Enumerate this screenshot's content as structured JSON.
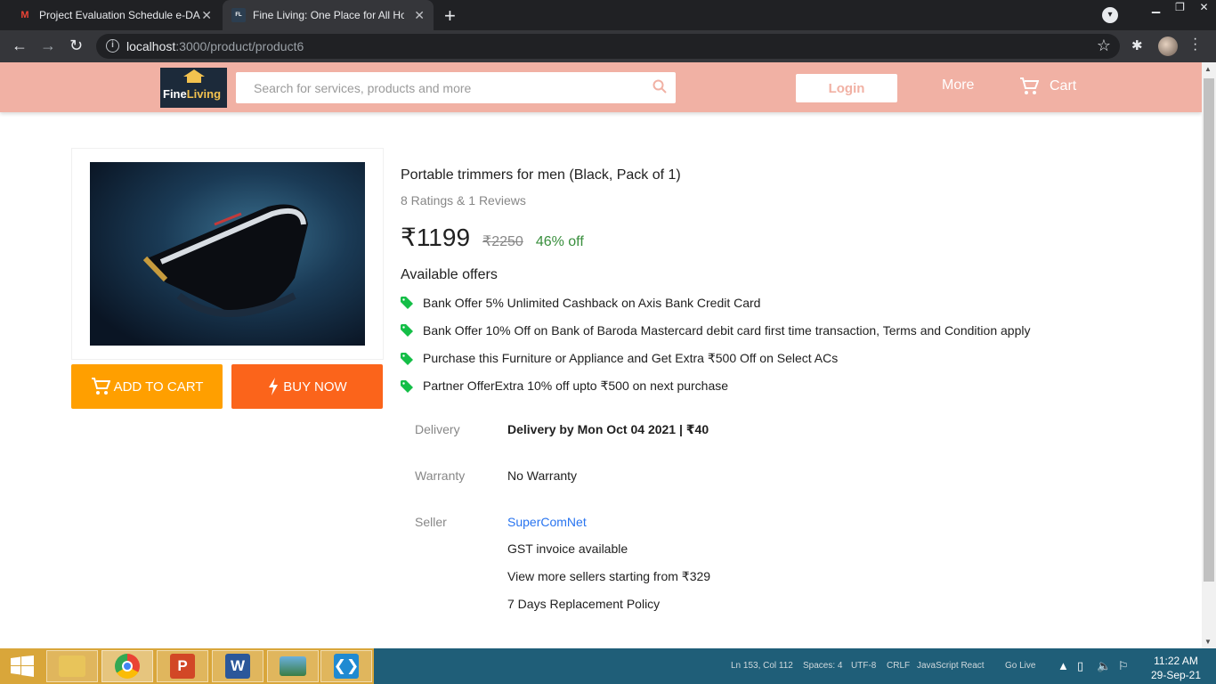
{
  "browser": {
    "tabs": [
      {
        "title": "Project Evaluation Schedule e-DA",
        "favicon": "gmail-icon"
      },
      {
        "title": "Fine Living: One Place for All Hou",
        "favicon": "fineliving-icon",
        "active": true
      }
    ],
    "url_host": "localhost",
    "url_path": ":3000/product/product6"
  },
  "header": {
    "logo_text_a": "Fine",
    "logo_text_b": "Living",
    "search_placeholder": "Search for services, products and more",
    "login_label": "Login",
    "more_label": "More",
    "cart_label": "Cart",
    "colors": {
      "header_bg": "#f1b1a4"
    }
  },
  "product": {
    "title": "Portable trimmers for men (Black, Pack of 1)",
    "ratings": "8 Ratings & 1 Reviews",
    "price": "₹1199",
    "mrp": "₹2250",
    "discount": "46% off",
    "add_to_cart_label": "ADD TO CART",
    "buy_now_label": "BUY NOW"
  },
  "offers": {
    "heading": "Available offers",
    "items": [
      "Bank Offer 5% Unlimited Cashback on Axis Bank Credit Card",
      "Bank Offer 10% Off on Bank of Baroda Mastercard debit card first time transaction, Terms and Condition apply",
      "Purchase this Furniture or Appliance and Get Extra ₹500 Off on Select ACs",
      "Partner OfferExtra 10% off upto ₹500 on next purchase"
    ]
  },
  "specs": {
    "delivery_label": "Delivery",
    "delivery_value": "Delivery by Mon Oct 04 2021 | ₹40",
    "warranty_label": "Warranty",
    "warranty_value": "No Warranty",
    "seller_label": "Seller",
    "seller_name": "SuperComNet",
    "seller_lines": [
      "GST invoice available",
      "View more sellers starting from ₹329",
      "7 Days Replacement Policy"
    ]
  },
  "taskbar": {
    "status_items": [
      "Ln 153, Col 112",
      "Spaces: 4",
      "UTF-8",
      "CRLF",
      "JavaScript React",
      "Go Live"
    ],
    "time": "11:22 AM",
    "date": "29-Sep-21"
  }
}
